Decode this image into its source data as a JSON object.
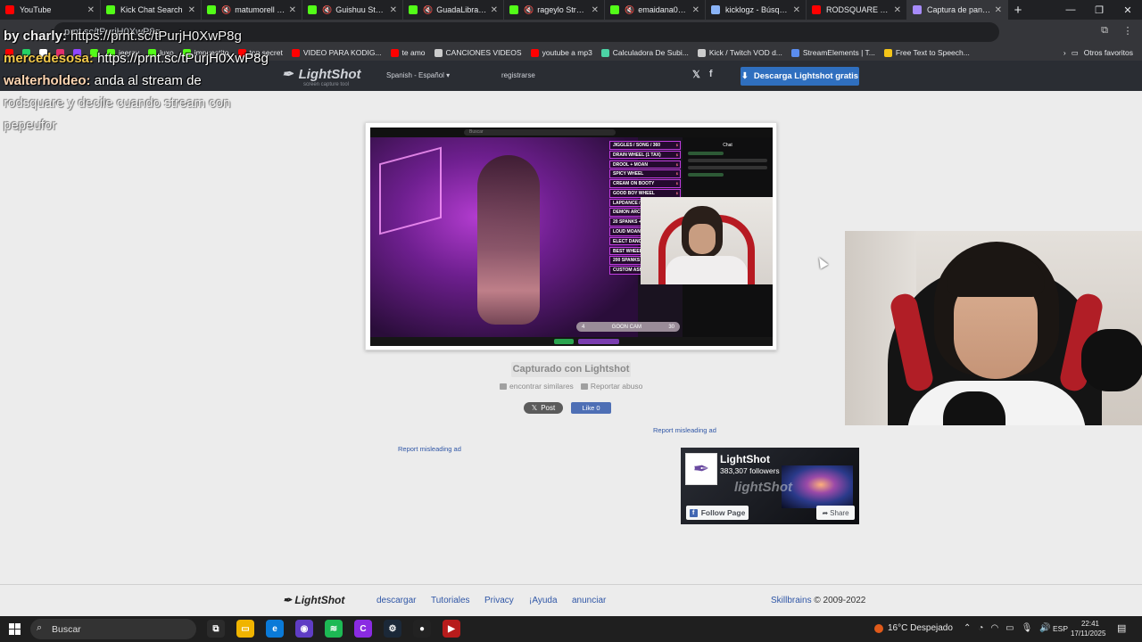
{
  "tabs": [
    {
      "title": "YouTube",
      "color": "#ff0000",
      "active": false,
      "muted": false,
      "fav": "YT"
    },
    {
      "title": "Kick Chat Search",
      "color": "#53fc18",
      "active": false,
      "muted": false,
      "fav": "K"
    },
    {
      "title": "matumorell Stream",
      "color": "#53fc18",
      "active": false,
      "muted": true,
      "fav": "K"
    },
    {
      "title": "Guishuu Stream",
      "color": "#53fc18",
      "active": false,
      "muted": true,
      "fav": "K"
    },
    {
      "title": "GuadaLibrandi",
      "color": "#53fc18",
      "active": false,
      "muted": true,
      "fav": "K"
    },
    {
      "title": "rageylo Stream",
      "color": "#53fc18",
      "active": false,
      "muted": true,
      "fav": "K"
    },
    {
      "title": "emaidana09 Stream",
      "color": "#53fc18",
      "active": false,
      "muted": true,
      "fav": "K"
    },
    {
      "title": "kicklogz - Búsqueda",
      "color": "#8ab4f8",
      "active": false,
      "muted": false,
      "fav": "G"
    },
    {
      "title": "RODSQUARE TROLO",
      "color": "#ff0000",
      "active": false,
      "muted": false,
      "fav": "YT"
    },
    {
      "title": "Captura de pantalla",
      "color": "#a78bfa",
      "active": true,
      "muted": false,
      "fav": "L"
    }
  ],
  "addressbar": {
    "url": "prnt.sc/tPurjH0XwP8g"
  },
  "bookmarks": [
    {
      "label": "",
      "color": "#ff0000"
    },
    {
      "label": "",
      "color": "#25d366"
    },
    {
      "label": "",
      "color": "#ffffff"
    },
    {
      "label": "",
      "color": "#e1306c"
    },
    {
      "label": "",
      "color": "#9146ff"
    },
    {
      "label": "",
      "color": "#53fc18"
    },
    {
      "label": "jeergy",
      "color": "#53fc18"
    },
    {
      "label": "luxo",
      "color": "#53fc18"
    },
    {
      "label": "impuestito",
      "color": "#53fc18"
    },
    {
      "label": "top secret",
      "color": "#ff0000"
    },
    {
      "label": "VIDEO PARA KODIG...",
      "color": "#ff0000"
    },
    {
      "label": "te amo",
      "color": "#ff0000"
    },
    {
      "label": "CANCIONES VIDEOS",
      "color": "#cccccc"
    },
    {
      "label": "youtube a mp3",
      "color": "#ff0000"
    },
    {
      "label": "Calculadora De Subi...",
      "color": "#4cd3a5"
    },
    {
      "label": "Kick / Twitch VOD d...",
      "color": "#cccccc"
    },
    {
      "label": "StreamElements | T...",
      "color": "#5b8def"
    },
    {
      "label": "Free Text to Speech...",
      "color": "#f5c518"
    }
  ],
  "bookmarks_other": "Otros favoritos",
  "chat": {
    "line1_user": "by charly:",
    "line1_text": " https://prnt.sc/tPurjH0XwP8g",
    "line2_user": "mercedesosa:",
    "line2_text": " https://prnt.sc/tPurjH0XwP8g",
    "line3_user": "walterholdeo:",
    "line3_text": " anda al stream de",
    "line4_text": "rodsquare y decile cuando stream con",
    "line5_text": "pepeufor"
  },
  "lightshot": {
    "logo": "LightShot",
    "tagline": "screen capture tool",
    "language": "Spanish - Español",
    "register": "registrarse",
    "download_btn": "Descarga Lightshot gratis",
    "caption": "Capturado con Lightshot",
    "find_similar": "encontrar similares",
    "report_abuse": "Reportar abuso",
    "x_post": "Post",
    "fb_like": "Like 0",
    "report_ad_1": "Report misleading ad",
    "report_ad_2": "Report misleading ad"
  },
  "screenshot": {
    "search_placeholder": "Buscar",
    "chat_header": "Chat",
    "menu_items": [
      {
        "label": "JIGGLES / SONG / 360",
        "price": "$ "
      },
      {
        "label": "DRAIN WHEEL (1 TAX)",
        "price": "$ "
      },
      {
        "label": "DROOL + MOAN",
        "price": "$ "
      },
      {
        "label": "SPICY WHEEL",
        "price": "$ "
      },
      {
        "label": "CREAM ON BOOTY",
        "price": "$ "
      },
      {
        "label": "GOOD BOY WHEEL",
        "price": "$ "
      },
      {
        "label": "LAPDANCE / SEX",
        "price": "$ "
      },
      {
        "label": "DEMON ARCH",
        "price": "$ "
      },
      {
        "label": "20 SPANKS +",
        "price": "$ "
      },
      {
        "label": "LOUD MOAN",
        "price": "$ "
      },
      {
        "label": "ELECT DANCE",
        "price": "$ "
      },
      {
        "label": "BEST WHEEL",
        "price": "$ "
      },
      {
        "label": "200 SPANKS",
        "price": "$ "
      },
      {
        "label": "CUSTOM ASMR",
        "price": "$ "
      }
    ],
    "goon_label": "GOON CAM",
    "goon_left": "4",
    "goon_right": "30"
  },
  "fb_widget": {
    "name": "LightShot",
    "followers": "383,307 followers",
    "brand": "lightShot",
    "follow": "Follow Page",
    "share": "Share"
  },
  "footer": {
    "logo": "LightShot",
    "links": [
      "descargar",
      "Tutoriales",
      "Privacy",
      "¡Ayuda",
      "anunciar"
    ],
    "copyright_link": "Skillbrains",
    "copyright_text": " © 2009-2022"
  },
  "taskbar": {
    "search": "Buscar",
    "weather": "16°C  Despejado",
    "lang": "ESP",
    "time": "22:41",
    "date": "17/11/2025"
  }
}
